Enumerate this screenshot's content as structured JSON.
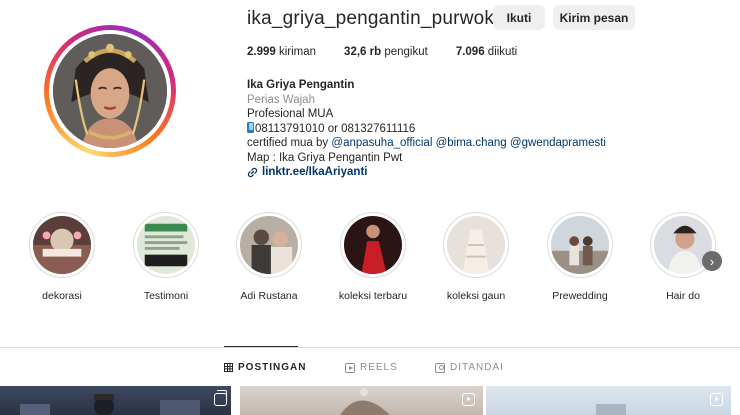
{
  "profile": {
    "username": "ika_griya_pengantin_purwokerto",
    "follow_label": "Ikuti",
    "message_label": "Kirim pesan",
    "stats": {
      "posts_value": "2.999",
      "posts_label": "kiriman",
      "followers_value": "32,6 rb",
      "followers_label": "pengikut",
      "following_value": "7.096",
      "following_label": "diikuti"
    },
    "bio": {
      "name": "Ika Griya Pengantin",
      "category": "Perias Wajah",
      "line1": "Profesional MUA",
      "phones": "08113791010 or 081327611116",
      "certified_prefix": "certified mua by",
      "mention1": "@anpasuha_official",
      "mention2": "@bima.chang",
      "mention3": "@gwendapramesti",
      "map": "Map : Ika Griya Pengantin Pwt",
      "link": "linktr.ee/IkaAriyanti"
    }
  },
  "highlights": [
    {
      "label": "dekorasi"
    },
    {
      "label": "Testimoni"
    },
    {
      "label": "Adi Rustana"
    },
    {
      "label": "koleksi terbaru"
    },
    {
      "label": "koleksi gaun"
    },
    {
      "label": "Prewedding"
    },
    {
      "label": "Hair do"
    }
  ],
  "tabs": {
    "posts": "POSTINGAN",
    "reels": "REELS",
    "tagged": "DITANDAI"
  },
  "icons": {
    "phone": "phone-icon",
    "link": "link-icon",
    "next": "chevron-right-icon",
    "grid": "grid-icon",
    "reels": "reels-icon",
    "tagged": "tagged-icon"
  },
  "colors": {
    "link": "#00376b",
    "muted": "#8e8e8e",
    "button_bg": "#efefef"
  }
}
